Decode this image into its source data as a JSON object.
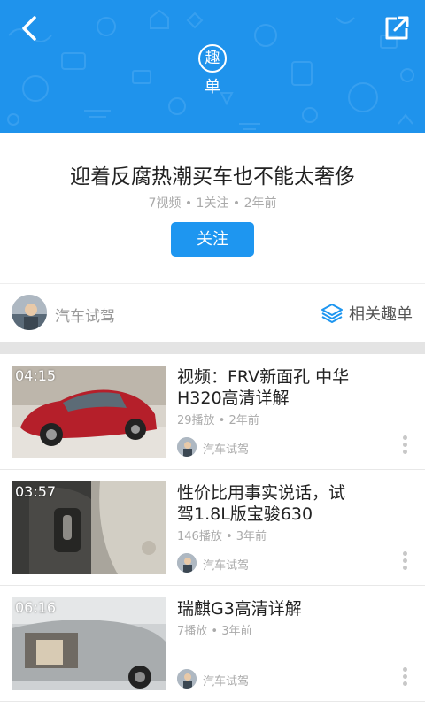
{
  "header": {
    "badge_char": "趣",
    "badge_sub": "单",
    "color": "#1f93ec"
  },
  "topic": {
    "title": "迎着反腐热潮买车也不能太奢侈",
    "meta": "7视频 • 1关注 • 2年前",
    "follow_label": "关注"
  },
  "author_bar": {
    "name": "汽车试驾",
    "related_label": "相关趣单",
    "accent": "#1e96f0"
  },
  "videos": [
    {
      "duration": "04:15",
      "title": "视频：FRV新面孔 中华H320高清详解",
      "meta": "29播放 • 2年前",
      "author": "汽车试驾"
    },
    {
      "duration": "03:57",
      "title": "性价比用事实说话，试驾1.8L版宝骏630",
      "meta": "146播放 • 3年前",
      "author": "汽车试驾"
    },
    {
      "duration": "06:16",
      "title": "瑞麒G3高清详解",
      "meta": "7播放 • 3年前",
      "author": "汽车试驾"
    }
  ]
}
